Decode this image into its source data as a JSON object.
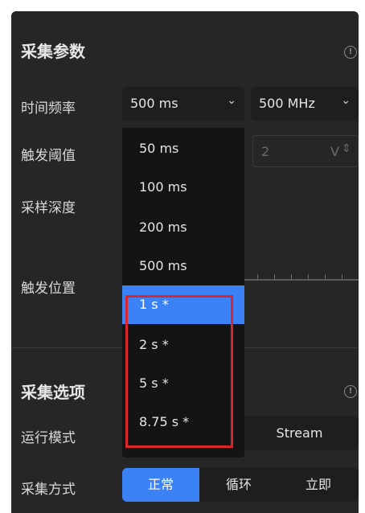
{
  "collection_params": {
    "title": "采集参数",
    "info_icon": "info-icon"
  },
  "time_freq": {
    "label": "时间频率",
    "time_value": "500 ms",
    "freq_value": "500 MHz"
  },
  "trigger_threshold": {
    "label": "触发阈值",
    "value": "2",
    "unit": "V"
  },
  "sample_depth": {
    "label": "采样深度"
  },
  "trigger_position": {
    "label": "触发位置"
  },
  "time_dropdown": {
    "options": [
      "50 ms",
      "100 ms",
      "200 ms",
      "500 ms",
      "1 s *",
      "2 s *",
      "5 s *",
      "8.75 s *"
    ],
    "selected": "1 s *"
  },
  "collection_options": {
    "title": "采集选项",
    "info_icon": "info-icon"
  },
  "run_mode": {
    "label": "运行模式",
    "option_stream": "Stream"
  },
  "collect_method": {
    "label": "采集方式",
    "options": [
      "正常",
      "循环",
      "立即"
    ],
    "selected": "正常"
  },
  "colors": {
    "panel_bg": "#262626",
    "accent": "#3b82f6",
    "highlight": "#d9262b"
  }
}
